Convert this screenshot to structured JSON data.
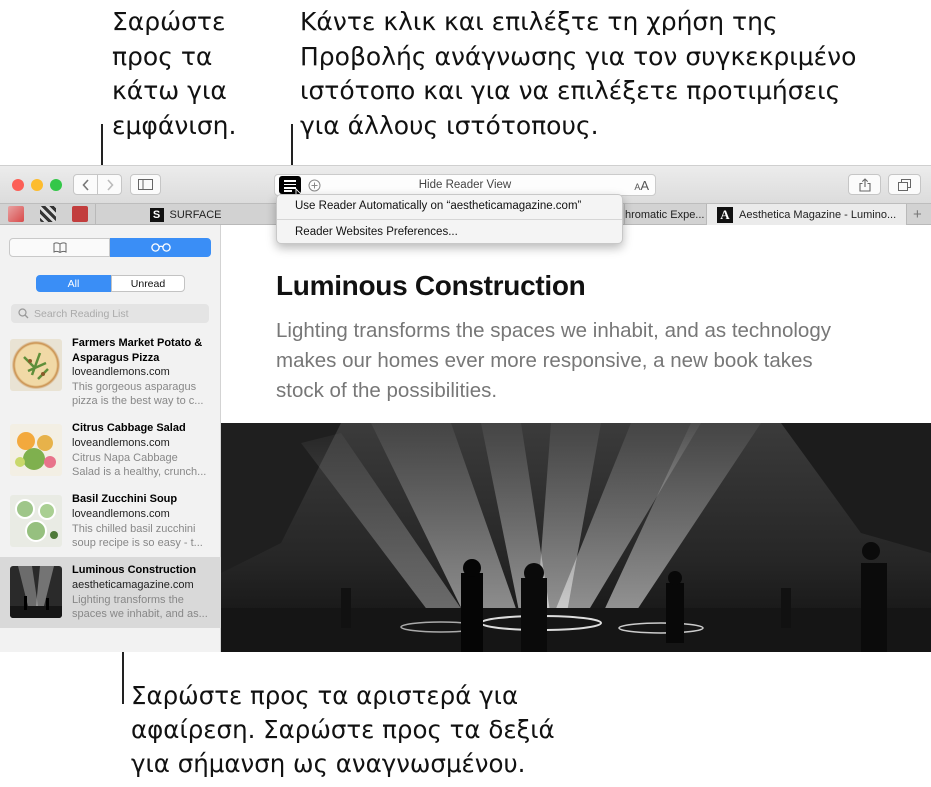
{
  "callouts": {
    "swipe_down": "Σαρώστε\nπρος τα\nκάτω για\nεμφάνιση.",
    "reader": "Κάντε κλικ και επιλέξτε τη χρήση της\nΠροβολής ανάγνωσης για τον συγκεκριμένο\nιστότοπο και για να επιλέξετε προτιμήσεις\nγια άλλους ιστότοπους.",
    "swipe_lr": "Σαρώστε προς τα αριστερά για\nαφαίρεση. Σαρώστε προς τα δεξιά\nγια σήμανση ως αναγνωσμένου."
  },
  "colors": {
    "accent": "#3a8ef6",
    "light_close": "#fc5f57",
    "light_minimize": "#fdbc2e",
    "light_zoom": "#33c748"
  },
  "toolbar": {
    "url_text": "Hide Reader View",
    "aa_label": "AA",
    "back_icon": "chevron-left-icon",
    "forward_icon": "chevron-right-icon",
    "sidebar_icon": "sidebar-icon",
    "share_icon": "share-icon",
    "tabs_icon": "tabs-overview-icon"
  },
  "tabs": [
    {
      "label": "SURFACE",
      "icon": "S"
    },
    {
      "label": "hromatic Expe..."
    },
    {
      "label": "Aesthetica Magazine - Lumino...",
      "icon": "A"
    }
  ],
  "reader_menu": {
    "auto_item": "Use Reader Automatically on “aestheticamagazine.com”",
    "prefs_item": "Reader Websites Preferences..."
  },
  "sidebar": {
    "filters": [
      "All",
      "Unread"
    ],
    "search_placeholder": "Search Reading List",
    "items": [
      {
        "title": "Farmers Market Potato & Asparagus Pizza",
        "domain": "loveandlemons.com",
        "desc1": "This gorgeous asparagus",
        "desc2": "pizza is the best way to c..."
      },
      {
        "title": "Citrus Cabbage Salad",
        "domain": "loveandlemons.com",
        "desc1": "Citrus Napa Cabbage",
        "desc2": "Salad is a healthy, crunch..."
      },
      {
        "title": "Basil Zucchini Soup",
        "domain": "loveandlemons.com",
        "desc1": "This chilled basil zucchini",
        "desc2": "soup recipe is so easy - t..."
      },
      {
        "title": "Luminous Construction",
        "domain": "aestheticamagazine.com",
        "desc1": "Lighting transforms the",
        "desc2": "spaces we inhabit, and as..."
      }
    ]
  },
  "article": {
    "title": "Luminous Construction",
    "lede": "Lighting transforms the spaces we inhabit, and as technology makes our homes ever more responsive, a new book takes stock of the possibilities."
  }
}
